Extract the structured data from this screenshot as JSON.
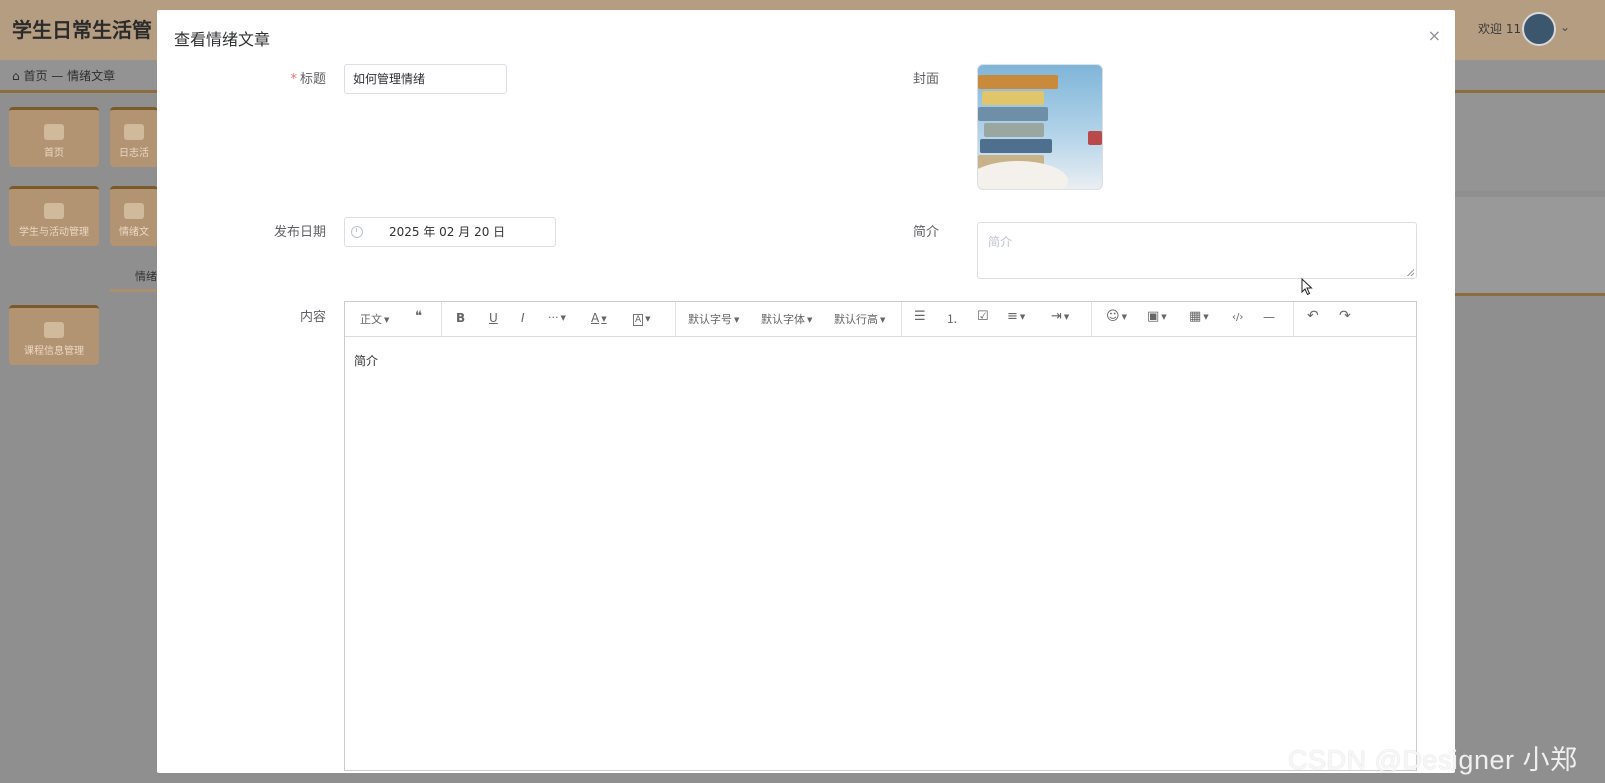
{
  "background": {
    "app_title": "学生日常生活管",
    "welcome": "欢迎 11",
    "breadcrumb": {
      "home": "首页",
      "separator": "—",
      "current": "情绪文章"
    },
    "tiles": [
      "首页",
      "日志活",
      "学生与活动管理",
      "情绪文",
      "课程信息管理"
    ],
    "active_tab": "情绪"
  },
  "modal": {
    "title": "查看情绪文章",
    "close": "×",
    "fields": {
      "title_label": "标题",
      "required_mark": "*",
      "title_value": "如何管理情绪",
      "cover_label": "封面",
      "date_label": "发布日期",
      "date_value": "2025 年 02 月 20 日",
      "intro_label": "简介",
      "intro_placeholder": "简介",
      "content_label": "内容",
      "content_body": "简介"
    },
    "toolbar": {
      "paragraph": "正文",
      "quote": "❝",
      "bold": "B",
      "underline": "U",
      "italic": "I",
      "more": "···",
      "font_color": "A",
      "bg_color": "A",
      "font_size": "默认字号",
      "font_family": "默认字体",
      "line_height": "默认行高",
      "bullet_list": "☰",
      "numbered_list": "⒈",
      "todo": "☑",
      "align": "≡",
      "indent": "⇥",
      "emoji": "☺",
      "image": "▣",
      "table": "▦",
      "code": "‹/›",
      "divider": "—",
      "undo": "↶",
      "redo": "↷"
    }
  },
  "watermark": "CSDN @Designer 小郑"
}
